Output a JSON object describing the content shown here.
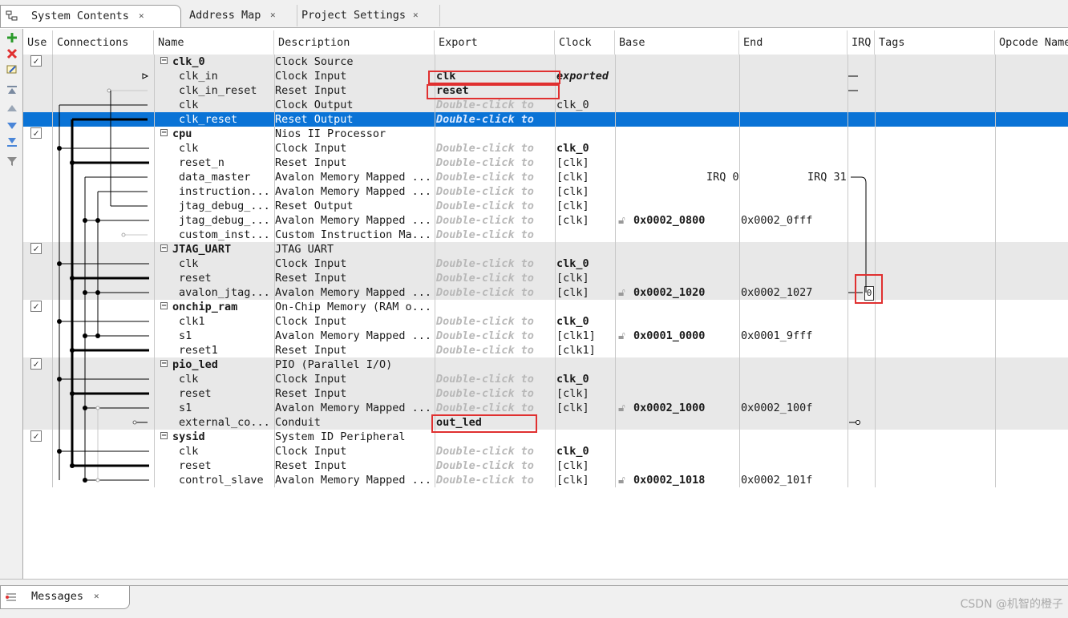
{
  "tabs": [
    {
      "label": "System Contents"
    },
    {
      "label": "Address Map"
    },
    {
      "label": "Project Settings"
    }
  ],
  "columns": {
    "use": "Use",
    "connections": "Connections",
    "name": "Name",
    "description": "Description",
    "export": "Export",
    "clock": "Clock",
    "base": "Base",
    "end": "End",
    "irq": "IRQ",
    "tags": "Tags",
    "opcode": "Opcode Name"
  },
  "rows": [
    {
      "kind": "module",
      "name": "clk_0",
      "desc": "Clock Source",
      "checked": true
    },
    {
      "name": "clk_in",
      "desc": "Clock Input",
      "export": "clk",
      "clock": "exported"
    },
    {
      "name": "clk_in_reset",
      "desc": "Reset Input",
      "export": "reset"
    },
    {
      "name": "clk",
      "desc": "Clock Output",
      "export": "Double-click to",
      "clock": "clk_0"
    },
    {
      "name": "clk_reset",
      "desc": "Reset Output",
      "export": "Double-click to",
      "selected": true
    },
    {
      "kind": "module",
      "name": "cpu",
      "desc": "Nios II Processor",
      "checked": true
    },
    {
      "name": "clk",
      "desc": "Clock Input",
      "export": "Double-click to",
      "clock": "clk_0"
    },
    {
      "name": "reset_n",
      "desc": "Reset Input",
      "export": "Double-click to",
      "clock": "[clk]"
    },
    {
      "name": "data_master",
      "desc": "Avalon Memory Mapped ...",
      "export": "Double-click to",
      "clock": "[clk]",
      "irq_left": "IRQ 0",
      "irq_right": "IRQ 31"
    },
    {
      "name": "instruction...",
      "desc": "Avalon Memory Mapped ...",
      "export": "Double-click to",
      "clock": "[clk]"
    },
    {
      "name": "jtag_debug_...",
      "desc": "Reset Output",
      "export": "Double-click to",
      "clock": "[clk]"
    },
    {
      "name": "jtag_debug_...",
      "desc": "Avalon Memory Mapped ...",
      "export": "Double-click to",
      "clock": "[clk]",
      "base": "0x0002_0800",
      "end": "0x0002_0fff"
    },
    {
      "name": "custom_inst...",
      "desc": "Custom Instruction Ma...",
      "export": "Double-click to"
    },
    {
      "kind": "module",
      "name": "JTAG_UART",
      "desc": "JTAG UART",
      "checked": true
    },
    {
      "name": "clk",
      "desc": "Clock Input",
      "export": "Double-click to",
      "clock": "clk_0"
    },
    {
      "name": "reset",
      "desc": "Reset Input",
      "export": "Double-click to",
      "clock": "[clk]"
    },
    {
      "name": "avalon_jtag...",
      "desc": "Avalon Memory Mapped ...",
      "export": "Double-click to",
      "clock": "[clk]",
      "base": "0x0002_1020",
      "end": "0x0002_1027",
      "irq": "0"
    },
    {
      "kind": "module",
      "name": "onchip_ram",
      "desc": "On-Chip Memory (RAM o...",
      "checked": true
    },
    {
      "name": "clk1",
      "desc": "Clock Input",
      "export": "Double-click to",
      "clock": "clk_0"
    },
    {
      "name": "s1",
      "desc": "Avalon Memory Mapped ...",
      "export": "Double-click to",
      "clock": "[clk1]",
      "base": "0x0001_0000",
      "end": "0x0001_9fff"
    },
    {
      "name": "reset1",
      "desc": "Reset Input",
      "export": "Double-click to",
      "clock": "[clk1]"
    },
    {
      "kind": "module",
      "name": "pio_led",
      "desc": "PIO (Parallel I/O)",
      "checked": true
    },
    {
      "name": "clk",
      "desc": "Clock Input",
      "export": "Double-click to",
      "clock": "clk_0"
    },
    {
      "name": "reset",
      "desc": "Reset Input",
      "export": "Double-click to",
      "clock": "[clk]"
    },
    {
      "name": "s1",
      "desc": "Avalon Memory Mapped ...",
      "export": "Double-click to",
      "clock": "[clk]",
      "base": "0x0002_1000",
      "end": "0x0002_100f"
    },
    {
      "name": "external_co...",
      "desc": "Conduit",
      "export": "out_led"
    },
    {
      "kind": "module",
      "name": "sysid",
      "desc": "System ID Peripheral",
      "checked": true
    },
    {
      "name": "clk",
      "desc": "Clock Input",
      "export": "Double-click to",
      "clock": "clk_0"
    },
    {
      "name": "reset",
      "desc": "Reset Input",
      "export": "Double-click to",
      "clock": "[clk]"
    },
    {
      "name": "control_slave",
      "desc": "Avalon Memory Mapped ...",
      "export": "Double-click to",
      "clock": "[clk]",
      "base": "0x0002_1018",
      "end": "0x0002_101f"
    }
  ],
  "messages": {
    "label": "Messages"
  },
  "watermark": "CSDN @机智的橙子",
  "colors": {
    "selection": "#0a73d6",
    "highlight": "#e03030",
    "moduleBand": "#e8e8e8"
  }
}
